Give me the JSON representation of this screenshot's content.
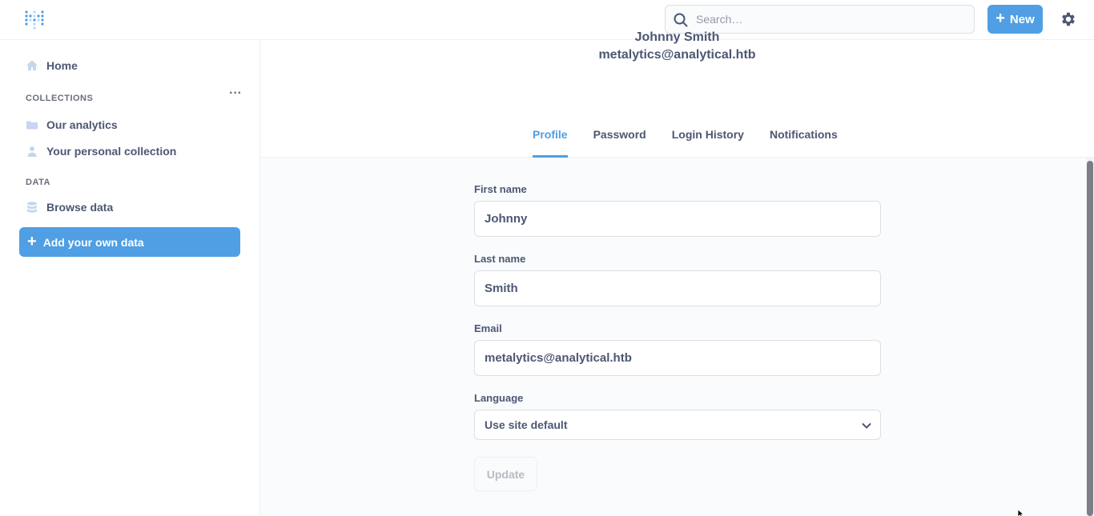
{
  "topbar": {
    "search_placeholder": "Search…",
    "new_label": "New"
  },
  "sidebar": {
    "home_label": "Home",
    "collections_heading": "COLLECTIONS",
    "collections": [
      {
        "label": "Our analytics"
      },
      {
        "label": "Your personal collection"
      }
    ],
    "data_heading": "DATA",
    "browse_data_label": "Browse data",
    "add_data_label": "Add your own data"
  },
  "profile": {
    "name": "Johnny Smith",
    "email": "metalytics@analytical.htb"
  },
  "tabs": [
    {
      "label": "Profile",
      "active": true
    },
    {
      "label": "Password",
      "active": false
    },
    {
      "label": "Login History",
      "active": false
    },
    {
      "label": "Notifications",
      "active": false
    }
  ],
  "form": {
    "first_name_label": "First name",
    "first_name_value": "Johnny",
    "last_name_label": "Last name",
    "last_name_value": "Smith",
    "email_label": "Email",
    "email_value": "metalytics@analytical.htb",
    "language_label": "Language",
    "language_value": "Use site default",
    "update_label": "Update"
  },
  "colors": {
    "brand": "#509ee3",
    "text": "#4c5773"
  }
}
